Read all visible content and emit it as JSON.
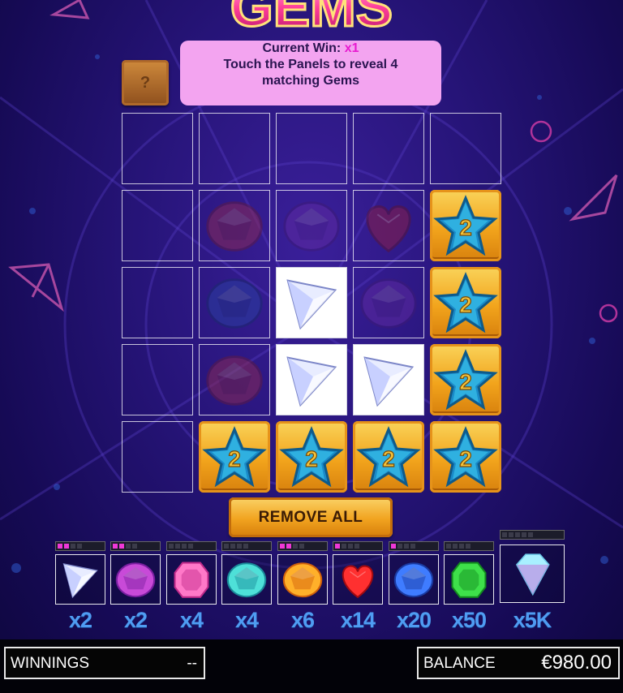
{
  "logo_text": "GEMS",
  "message": {
    "current_win_label": "Current Win:",
    "current_win_value": "x1",
    "instruction": "Touch the Panels to reveal 4 matching Gems"
  },
  "help_button": "?",
  "grid": {
    "rows": [
      [
        "empty",
        "empty",
        "empty",
        "empty",
        "empty"
      ],
      [
        "empty",
        "gem-red",
        "gem-purple",
        "gem-heart",
        "star-2"
      ],
      [
        "empty",
        "gem-blue",
        "diamond",
        "gem-purple",
        "star-2"
      ],
      [
        "empty",
        "gem-red",
        "diamond",
        "diamond",
        "star-2"
      ],
      [
        "empty",
        "star-2",
        "star-2",
        "star-2",
        "star-2"
      ]
    ],
    "star_value": "2"
  },
  "remove_all_label": "REMOVE ALL",
  "paytable": [
    {
      "gem": "diamond",
      "multiplier": "x2",
      "progress": 2,
      "slots": 4
    },
    {
      "gem": "purple-gem",
      "multiplier": "x2",
      "progress": 2,
      "slots": 4
    },
    {
      "gem": "pink-gem",
      "multiplier": "x4",
      "progress": 0,
      "slots": 4
    },
    {
      "gem": "teal-gem",
      "multiplier": "x4",
      "progress": 0,
      "slots": 4
    },
    {
      "gem": "orange-gem",
      "multiplier": "x6",
      "progress": 2,
      "slots": 4
    },
    {
      "gem": "red-heart",
      "multiplier": "x14",
      "progress": 1,
      "slots": 4
    },
    {
      "gem": "blue-gem",
      "multiplier": "x20",
      "progress": 1,
      "slots": 4
    },
    {
      "gem": "green-gem",
      "multiplier": "x50",
      "progress": 0,
      "slots": 4
    },
    {
      "gem": "big-diamond",
      "multiplier": "x5K",
      "progress": 0,
      "slots": 5
    }
  ],
  "winnings": {
    "label": "WINNINGS",
    "value": "--"
  },
  "balance": {
    "label": "BALANCE",
    "value": "€980.00"
  },
  "colors": {
    "bonus": "#f2a41c",
    "message_bg": "#f3a4f0",
    "pip_on": "#f038d8",
    "multiplier": "#4f9cf2"
  }
}
